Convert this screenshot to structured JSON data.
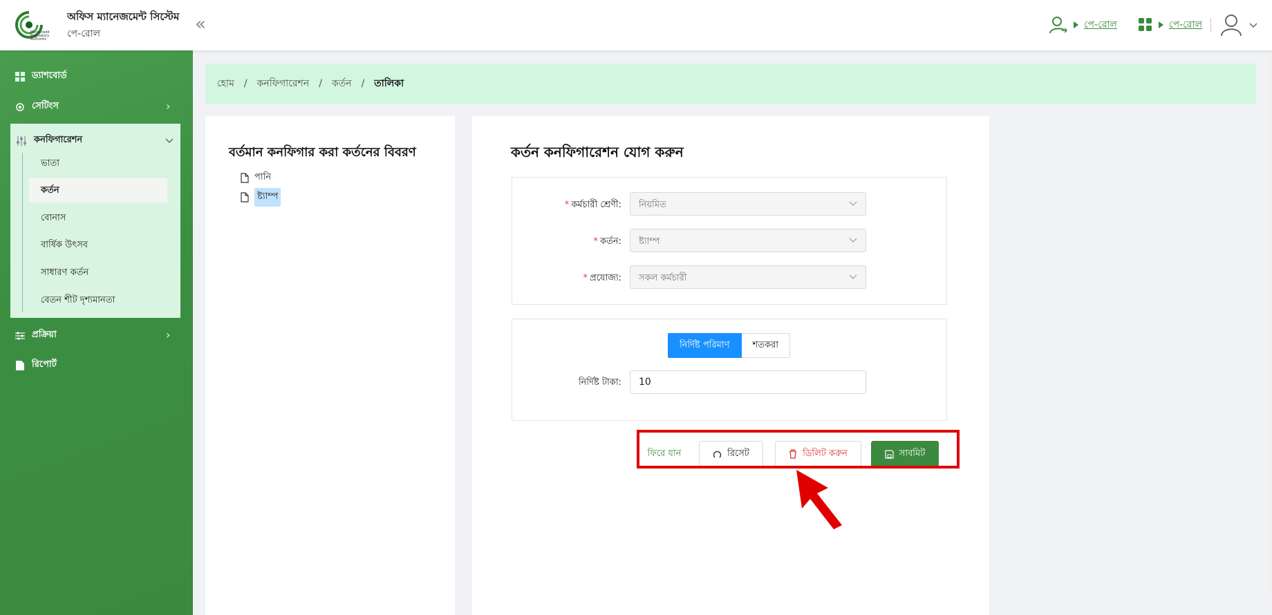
{
  "header": {
    "app_title": "অফিস ম্যানেজমেন্ট সিস্টেম",
    "app_subtitle": "পে-রোল",
    "logo_text": "Microcredit Regulatory Authority",
    "links": [
      "পে-রোল",
      "পে-রোল"
    ]
  },
  "sidebar": {
    "items": [
      {
        "label": "ড্যাশবোর্ড",
        "icon": "dashboard-icon"
      },
      {
        "label": "সেটিংস",
        "icon": "gear-icon"
      },
      {
        "label": "কনফিগারেশন",
        "icon": "sliders-icon"
      },
      {
        "label": "প্রক্রিয়া",
        "icon": "process-icon"
      },
      {
        "label": "রিপোর্ট",
        "icon": "file-icon"
      }
    ],
    "config_submenu": [
      "ভাতা",
      "কর্তন",
      "বোনাস",
      "বার্ষিক উৎসব",
      "সাধারণ কর্তন",
      "বেতন শীট দৃশ্যমানতা"
    ]
  },
  "breadcrumb": [
    "হোম",
    "কনফিগারেশন",
    "কর্তন",
    "তালিকা"
  ],
  "left_panel": {
    "title": "বর্তমান কনফিগার করা কর্তনের বিবরণ",
    "tree": [
      "পানি",
      "ষ্ট্যাম্প"
    ]
  },
  "form": {
    "title": "কর্তন কনফিগারেশন যোগ করুন",
    "fields": [
      {
        "label": "কর্মচারী শ্রেণী:",
        "value": "নিয়মিত"
      },
      {
        "label": "কর্তন:",
        "value": "ষ্ট্যাম্প"
      },
      {
        "label": "প্রযোজ্য:",
        "value": "সকল কর্মচারী"
      }
    ],
    "segment": {
      "selected": "নির্দিষ্ট পরিমাণ",
      "other": "শতকরা"
    },
    "amount_label": "নির্দিষ্ট টাকা:",
    "amount_value": "10",
    "buttons": {
      "back": "ফিরে যান",
      "reset": "রিসেট",
      "delete": "ডিলিট করুন",
      "submit": "সাবমিট"
    }
  },
  "colors": {
    "brand_green": "#3b8a3f",
    "breadcrumb_bg": "#d3f6e0",
    "primary_blue": "#1890ff",
    "danger": "#e03131",
    "highlight": "#e00000"
  }
}
